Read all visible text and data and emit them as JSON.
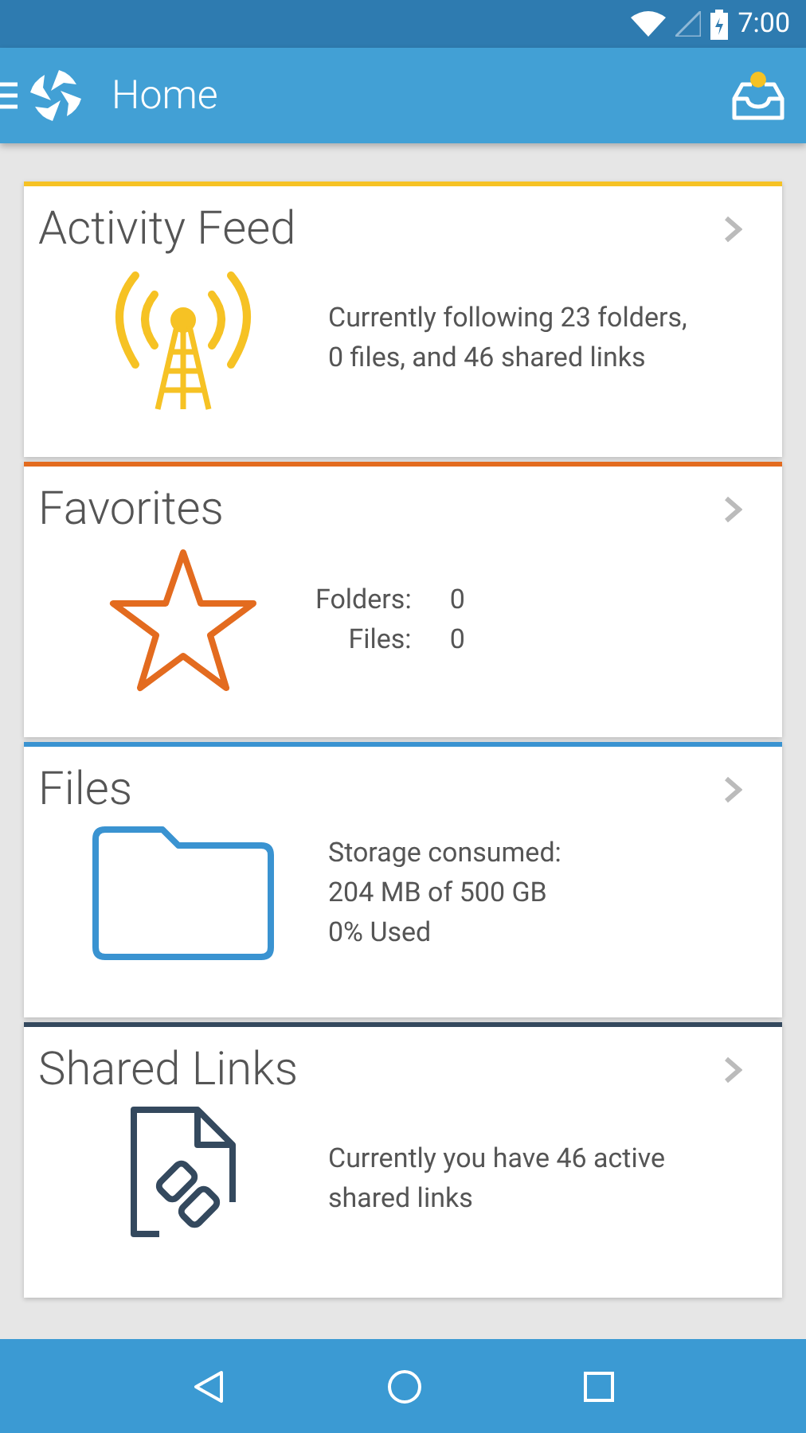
{
  "status_bar": {
    "time": "7:00"
  },
  "app_bar": {
    "title": "Home",
    "inbox_unread": true
  },
  "cards": [
    {
      "title": "Activity Feed",
      "kind": "feed",
      "color": "#f6c224",
      "lines": [
        "Currently following 23 folders,",
        "0 files, and 46 shared links"
      ]
    },
    {
      "title": "Favorites",
      "kind": "favorites",
      "color": "#e36b1f",
      "stats": [
        {
          "label": "Folders:",
          "value": "0"
        },
        {
          "label": "Files:",
          "value": "0"
        }
      ]
    },
    {
      "title": "Files",
      "kind": "files",
      "color": "#3a93d1",
      "lines": [
        "Storage consumed:",
        "204 MB of 500 GB",
        "0% Used"
      ]
    },
    {
      "title": "Shared Links",
      "kind": "links",
      "color": "#34495e",
      "lines": [
        "Currently you have 46 active",
        "shared links"
      ]
    }
  ]
}
